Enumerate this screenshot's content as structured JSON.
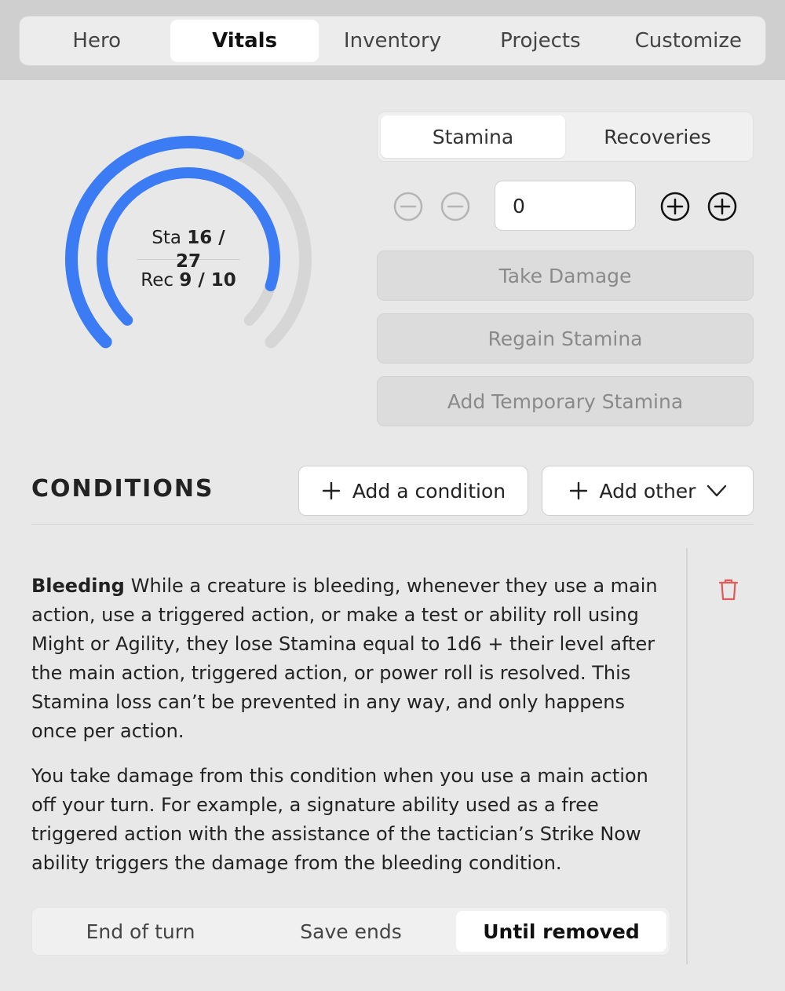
{
  "tabs": [
    {
      "label": "Hero",
      "active": false
    },
    {
      "label": "Vitals",
      "active": true
    },
    {
      "label": "Inventory",
      "active": false
    },
    {
      "label": "Projects",
      "active": false
    },
    {
      "label": "Customize",
      "active": false
    }
  ],
  "gauge": {
    "stamina_label": "Sta",
    "stamina_value": "16 / 27",
    "stamina_current": 16,
    "stamina_max": 27,
    "recoveries_label": "Rec",
    "recoveries_value": "9 / 10",
    "recoveries_current": 9,
    "recoveries_max": 10,
    "accent_color": "#3b7cf5",
    "track_color": "#d6d6d6"
  },
  "vitals_mode": {
    "options": [
      "Stamina",
      "Recoveries"
    ],
    "selected": "Stamina"
  },
  "adjuster": {
    "value": "0",
    "decrement_icons": [
      "minus-circle-icon",
      "minus-circle-icon"
    ],
    "increment_icons": [
      "plus-circle-icon",
      "plus-circle-icon"
    ]
  },
  "actions": {
    "take_damage": "Take Damage",
    "regain_stamina": "Regain Stamina",
    "add_temporary_stamina": "Add Temporary Stamina"
  },
  "conditions": {
    "title": "CONDITIONS",
    "add_condition_label": "Add a condition",
    "add_other_label": "Add other",
    "items": [
      {
        "name": "Bleeding",
        "description": "While a creature is bleeding, whenever they use a main action, use a triggered action, or make a test or ability roll using Might or Agility, they lose Stamina equal to 1d6 + their level after the main action, triggered action, or power roll is resolved. This Stamina loss can’t be prevented in any way, and only happens once per action.",
        "note": "You take damage from this condition when you use a main action off your turn. For example, a signature ability used as a free triggered action with the assistance of the tactician’s Strike Now ability triggers the damage from the bleeding condition.",
        "durations": [
          "End of turn",
          "Save ends",
          "Until removed"
        ],
        "selected_duration": "Until removed",
        "delete_icon": "trash-icon",
        "delete_color": "#e05a5a"
      }
    ]
  }
}
